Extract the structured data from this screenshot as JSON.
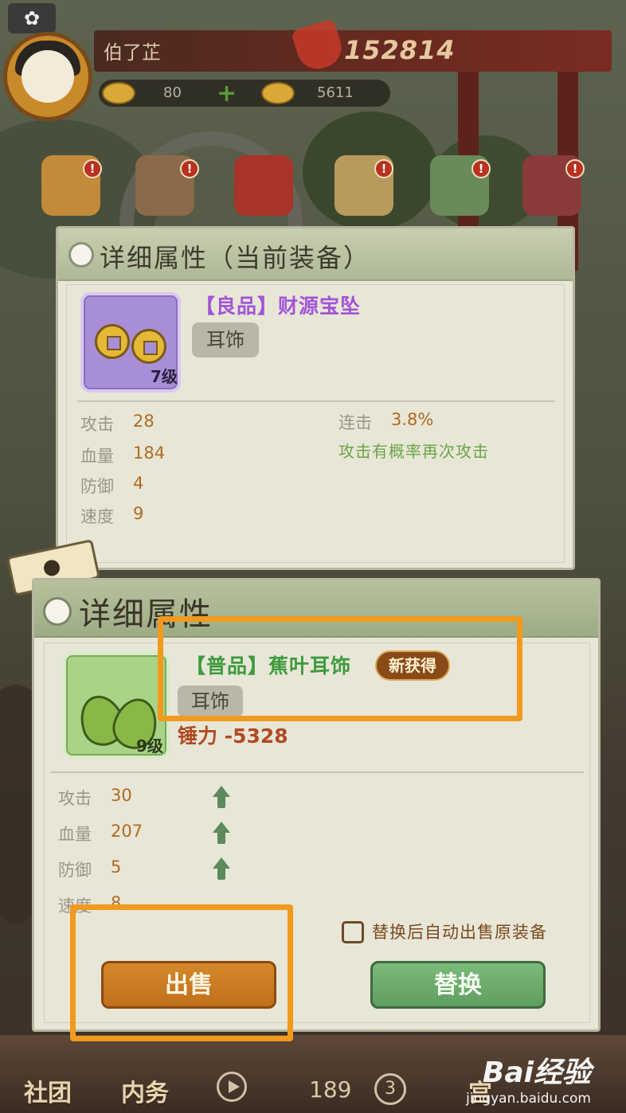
{
  "header": {
    "player_name": "伯了芷",
    "combat_power": "152814",
    "currency_gold": "80",
    "currency_ingot": "5611",
    "add_symbol": "+"
  },
  "menu": {
    "badge_symbol": "!"
  },
  "current_equipment": {
    "title": "详细属性（当前装备）",
    "item_name": "【良品】财源宝坠",
    "item_type": "耳饰",
    "item_level": "7级",
    "stats": [
      {
        "label": "攻击",
        "value": "28"
      },
      {
        "label": "血量",
        "value": "184"
      },
      {
        "label": "防御",
        "value": "4"
      },
      {
        "label": "速度",
        "value": "9"
      }
    ],
    "special_label": "连击",
    "special_value": "3.8%",
    "special_desc": "攻击有概率再次攻击"
  },
  "new_equipment": {
    "title": "详细属性",
    "item_name": "【普品】蕉叶耳饰",
    "new_badge": "新获得",
    "item_type": "耳饰",
    "item_level": "9级",
    "power_change": "锤力 -5328",
    "stats": [
      {
        "label": "攻击",
        "value": "30"
      },
      {
        "label": "血量",
        "value": "207"
      },
      {
        "label": "防御",
        "value": "5"
      },
      {
        "label": "速度",
        "value": "8"
      }
    ],
    "auto_sell_label": "替换后自动出售原装备",
    "sell_button": "出售",
    "replace_button": "替换"
  },
  "bottom_nav": {
    "guild": "社团",
    "affairs": "内务",
    "count": "189",
    "circle_num": "3",
    "palace": "宫"
  },
  "watermark": {
    "logo": "Bai经验",
    "url": "jingyan.baidu.com"
  },
  "colors": {
    "quality_good": "#a255d8",
    "quality_normal": "#3e9a3e",
    "stat_value": "#b06a22",
    "highlight": "#f29a1e",
    "sell_button": "#c97a20",
    "replace_button": "#6eac6e"
  }
}
